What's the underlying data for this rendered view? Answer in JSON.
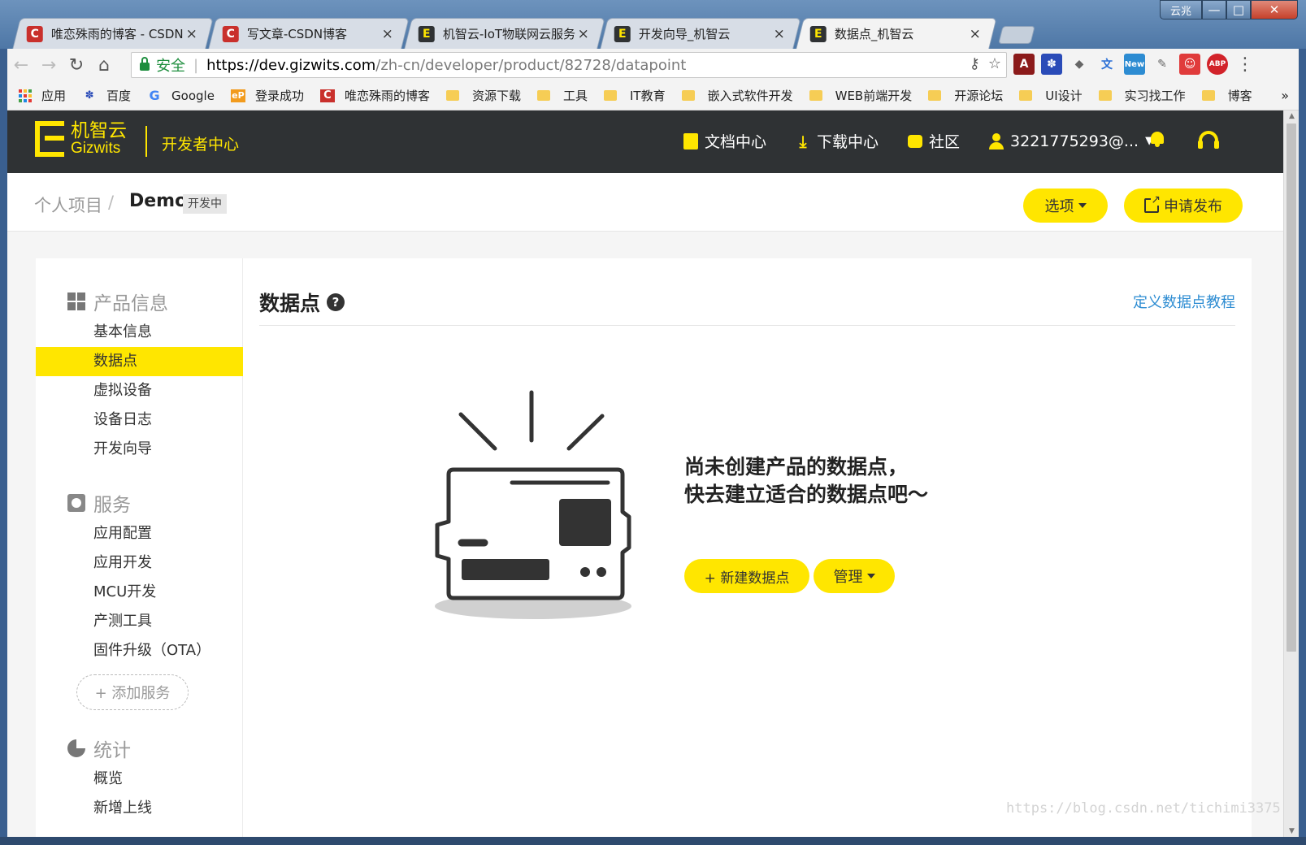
{
  "browser": {
    "tabs": [
      {
        "title": "唯恋殊雨的博客 - CSDN",
        "favicon": "csdn-icon",
        "active": false
      },
      {
        "title": "写文章-CSDN博客",
        "favicon": "csdn-icon",
        "active": false
      },
      {
        "title": "机智云-IoT物联网云服务",
        "favicon": "gizwits-icon",
        "active": false
      },
      {
        "title": "开发向导_机智云",
        "favicon": "gizwits-icon",
        "active": false
      },
      {
        "title": "数据点_机智云",
        "favicon": "gizwits-icon",
        "active": true
      }
    ],
    "window_controls": {
      "yunzhao": "云兆",
      "minimize": "—",
      "maximize": "□",
      "close": "✕"
    },
    "address": {
      "secure_label": "安全",
      "url_base": "https://dev.gizwits.com",
      "url_path": "/zh-cn/developer/product/82728/datapoint"
    },
    "bookmarks": [
      {
        "label": "应用",
        "icon": "apps-icon"
      },
      {
        "label": "百度",
        "icon": "baidu-icon"
      },
      {
        "label": "Google",
        "icon": "google-icon"
      },
      {
        "label": "登录成功",
        "icon": "ep-icon"
      },
      {
        "label": "唯恋殊雨的博客",
        "icon": "csdn-icon"
      },
      {
        "label": "资源下载",
        "icon": "folder-icon"
      },
      {
        "label": "工具",
        "icon": "folder-icon"
      },
      {
        "label": "IT教育",
        "icon": "folder-icon"
      },
      {
        "label": "嵌入式软件开发",
        "icon": "folder-icon"
      },
      {
        "label": "WEB前端开发",
        "icon": "folder-icon"
      },
      {
        "label": "开源论坛",
        "icon": "folder-icon"
      },
      {
        "label": "UI设计",
        "icon": "folder-icon"
      },
      {
        "label": "实习找工作",
        "icon": "folder-icon"
      },
      {
        "label": "博客",
        "icon": "folder-icon"
      }
    ],
    "bookmarks_more": "»",
    "extensions": {
      "new_badge": "New",
      "abp": "ABP"
    }
  },
  "site": {
    "logo_cn": "机智云",
    "logo_en": "Gizwits",
    "dev_center": "开发者中心",
    "nav": {
      "docs": "文档中心",
      "download": "下载中心",
      "community": "社区",
      "user": "3221775293@..."
    }
  },
  "breadcrumb": {
    "root": "个人项目",
    "slash": "/",
    "current": "Demo",
    "status": "开发中"
  },
  "actions": {
    "options": "选项",
    "publish": "申请发布"
  },
  "sidebar": {
    "product_info": {
      "title": "产品信息",
      "items": [
        "基本信息",
        "数据点",
        "虚拟设备",
        "设备日志",
        "开发向导"
      ]
    },
    "services": {
      "title": "服务",
      "items": [
        "应用配置",
        "应用开发",
        "MCU开发",
        "产测工具",
        "固件升级（OTA）"
      ],
      "add": "+ 添加服务"
    },
    "stats": {
      "title": "统计",
      "items": [
        "概览",
        "新增上线"
      ]
    },
    "active_item": "数据点"
  },
  "main": {
    "title": "数据点",
    "help": "?",
    "tutorial_link": "定义数据点教程",
    "empty_line1": "尚未创建产品的数据点，",
    "empty_line2": "快去建立适合的数据点吧～",
    "new_button": "+ 新建数据点",
    "manage_button": "管理"
  },
  "watermark": "https://blog.csdn.net/tichimi3375",
  "colors": {
    "brand_yellow": "#ffe600",
    "header_dark": "#2f3234",
    "link_blue": "#2d8cd2",
    "secure_green": "#1e8e3e"
  }
}
